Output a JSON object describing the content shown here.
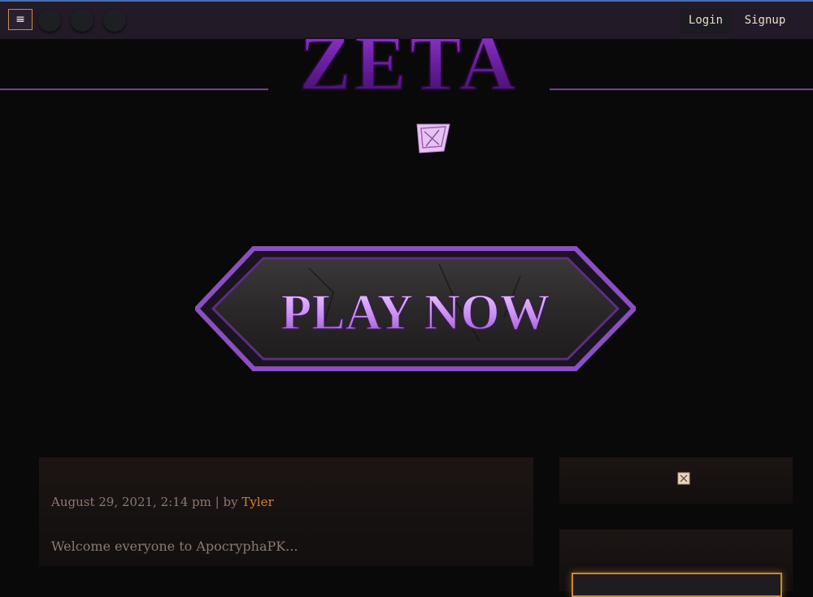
{
  "topbar": {
    "menu_icon": "hamburger-menu-icon",
    "menu_glyph": "≡",
    "login_label": "Login",
    "signup_label": "Signup"
  },
  "header": {
    "logo_text": "ZETA",
    "logo_color": "#6a1fa0"
  },
  "hero": {
    "play_button_label": "PLAY NOW",
    "play_text_color": "#c98df0",
    "play_frame_color": "#8b4fc1"
  },
  "post": {
    "date": "August 29, 2021, 2:14 pm",
    "by_separator": " | by ",
    "author": "Tyler",
    "excerpt": "Welcome everyone to ApocryphaPK..."
  },
  "colors": {
    "accent": "#d9822b",
    "purple_line": "#7b3f98",
    "topbar_bg": "#231a28"
  }
}
